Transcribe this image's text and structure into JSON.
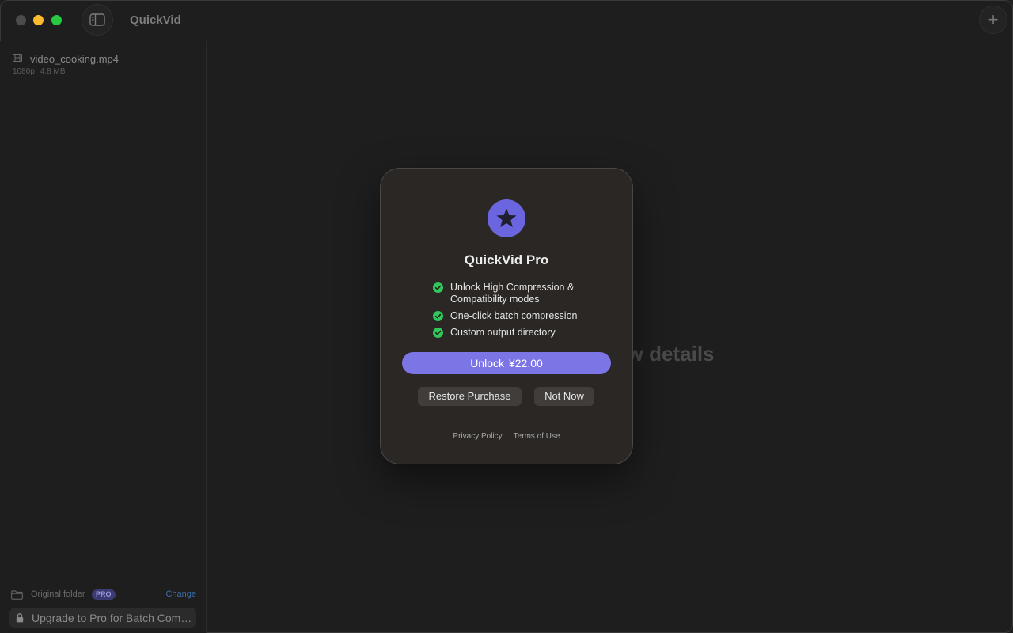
{
  "app": {
    "title": "QuickVid"
  },
  "toolbar": {
    "add_label": "+"
  },
  "sidebar": {
    "files": [
      {
        "name": "video_cooking.mp4",
        "resolution": "1080p",
        "size": "4.8 MB"
      }
    ],
    "output": {
      "folder_label": "Original folder",
      "badge": "PRO",
      "change_label": "Change"
    },
    "upgrade_label": "Upgrade to Pro for Batch Comp..."
  },
  "main": {
    "placeholder_text": "iew details"
  },
  "modal": {
    "title": "QuickVid Pro",
    "features": [
      "Unlock High Compression & Compatibility modes",
      "One-click batch compression",
      "Custom output directory"
    ],
    "unlock_label": "Unlock",
    "price": "¥22.00",
    "restore_label": "Restore Purchase",
    "not_now_label": "Not Now",
    "privacy_label": "Privacy Policy",
    "terms_label": "Terms of Use"
  },
  "colors": {
    "accent": "#7b75e6",
    "star_badge": "#6b66e0",
    "check_green": "#30c85a",
    "link_blue": "#3c6ea8"
  },
  "icons": [
    "sidebar-toggle-icon",
    "film-icon",
    "folder-icon",
    "lock-icon",
    "star-icon",
    "check-icon",
    "plus-icon"
  ]
}
